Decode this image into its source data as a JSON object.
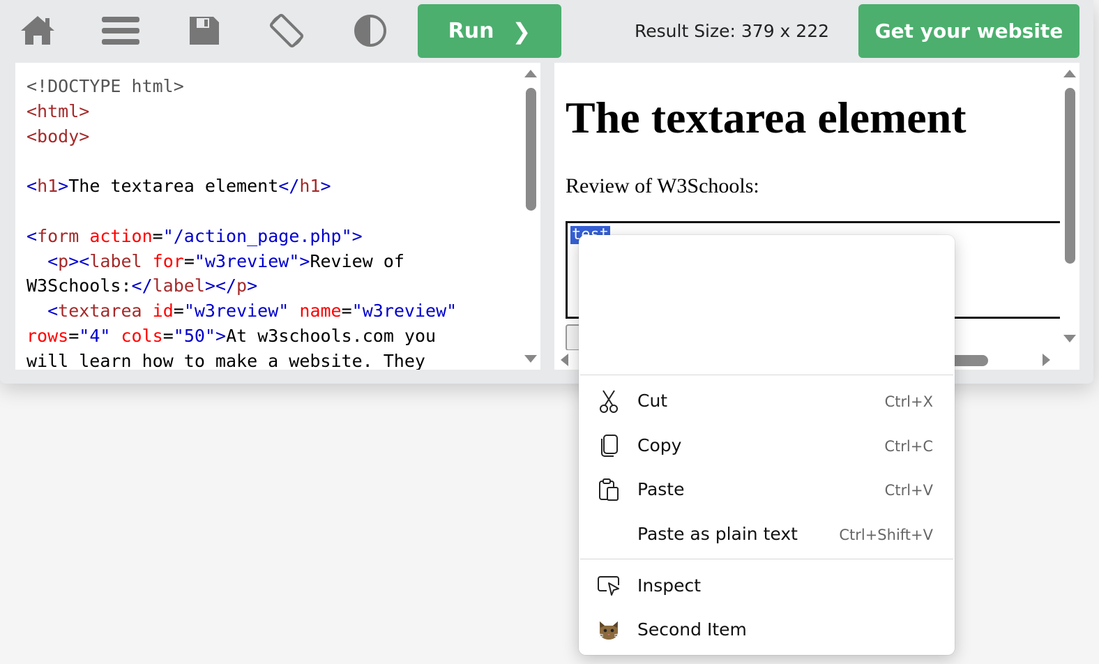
{
  "toolbar": {
    "icons": [
      "home-icon",
      "menu-icon",
      "save-icon",
      "rotate-icon",
      "contrast-icon"
    ],
    "run_label": "Run",
    "run_chevron": "❯",
    "result_size": "Result Size: 379 x 222",
    "get_website_label": "Get your website"
  },
  "code": {
    "lines": [
      [
        {
          "t": "doctype",
          "s": "<!DOCTYPE html>"
        }
      ],
      [
        {
          "t": "tag",
          "s": "<html>"
        }
      ],
      [
        {
          "t": "tag",
          "s": "<body>"
        }
      ],
      [],
      [
        {
          "t": "pun",
          "s": "<"
        },
        {
          "t": "tag",
          "s": "h1"
        },
        {
          "t": "pun",
          "s": ">"
        },
        {
          "t": "txt",
          "s": "The textarea element"
        },
        {
          "t": "pun",
          "s": "</"
        },
        {
          "t": "tag",
          "s": "h1"
        },
        {
          "t": "pun",
          "s": ">"
        }
      ],
      [],
      [
        {
          "t": "pun",
          "s": "<"
        },
        {
          "t": "tag",
          "s": "form "
        },
        {
          "t": "attr",
          "s": "action"
        },
        {
          "t": "txt",
          "s": "="
        },
        {
          "t": "val",
          "s": "\"/action_page.php\""
        },
        {
          "t": "pun",
          "s": ">"
        }
      ],
      [
        {
          "t": "txt",
          "s": "  "
        },
        {
          "t": "pun",
          "s": "<"
        },
        {
          "t": "tag",
          "s": "p"
        },
        {
          "t": "pun",
          "s": "><"
        },
        {
          "t": "tag",
          "s": "label "
        },
        {
          "t": "attr",
          "s": "for"
        },
        {
          "t": "txt",
          "s": "="
        },
        {
          "t": "val",
          "s": "\"w3review\""
        },
        {
          "t": "pun",
          "s": ">"
        },
        {
          "t": "txt",
          "s": "Review of"
        }
      ],
      [
        {
          "t": "txt",
          "s": "W3Schools:"
        },
        {
          "t": "pun",
          "s": "</"
        },
        {
          "t": "tag",
          "s": "label"
        },
        {
          "t": "pun",
          "s": "></"
        },
        {
          "t": "tag",
          "s": "p"
        },
        {
          "t": "pun",
          "s": ">"
        }
      ],
      [
        {
          "t": "txt",
          "s": "  "
        },
        {
          "t": "pun",
          "s": "<"
        },
        {
          "t": "tag",
          "s": "textarea "
        },
        {
          "t": "attr",
          "s": "id"
        },
        {
          "t": "txt",
          "s": "="
        },
        {
          "t": "val",
          "s": "\"w3review\" "
        },
        {
          "t": "attr",
          "s": "name"
        },
        {
          "t": "txt",
          "s": "="
        },
        {
          "t": "val",
          "s": "\"w3review\""
        }
      ],
      [
        {
          "t": "attr",
          "s": "rows"
        },
        {
          "t": "txt",
          "s": "="
        },
        {
          "t": "val",
          "s": "\"4\" "
        },
        {
          "t": "attr",
          "s": "cols"
        },
        {
          "t": "txt",
          "s": "="
        },
        {
          "t": "val",
          "s": "\"50\""
        },
        {
          "t": "pun",
          "s": ">"
        },
        {
          "t": "txt",
          "s": "At w3schools.com you"
        }
      ],
      [
        {
          "t": "txt",
          "s": "will learn how to make a website. They"
        }
      ]
    ]
  },
  "result": {
    "heading": "The textarea element",
    "label": "Review of W3Schools:",
    "textarea_selected": "test"
  },
  "context_menu": {
    "items": [
      {
        "icon": "scissors-icon",
        "label": "Cut",
        "shortcut": "Ctrl+X"
      },
      {
        "icon": "copy-icon",
        "label": "Copy",
        "shortcut": "Ctrl+C"
      },
      {
        "icon": "clipboard-icon",
        "label": "Paste",
        "shortcut": "Ctrl+V"
      },
      {
        "icon": "",
        "label": "Paste as plain text",
        "shortcut": "Ctrl+Shift+V"
      },
      {
        "icon": "inspect-icon",
        "label": "Inspect",
        "shortcut": ""
      },
      {
        "icon": "cat-icon",
        "label": "Second Item",
        "shortcut": ""
      }
    ]
  },
  "colors": {
    "accent_green": "#4caf6e",
    "selection_blue": "#3560d6",
    "toolbar_bg": "#e7e9eb"
  }
}
